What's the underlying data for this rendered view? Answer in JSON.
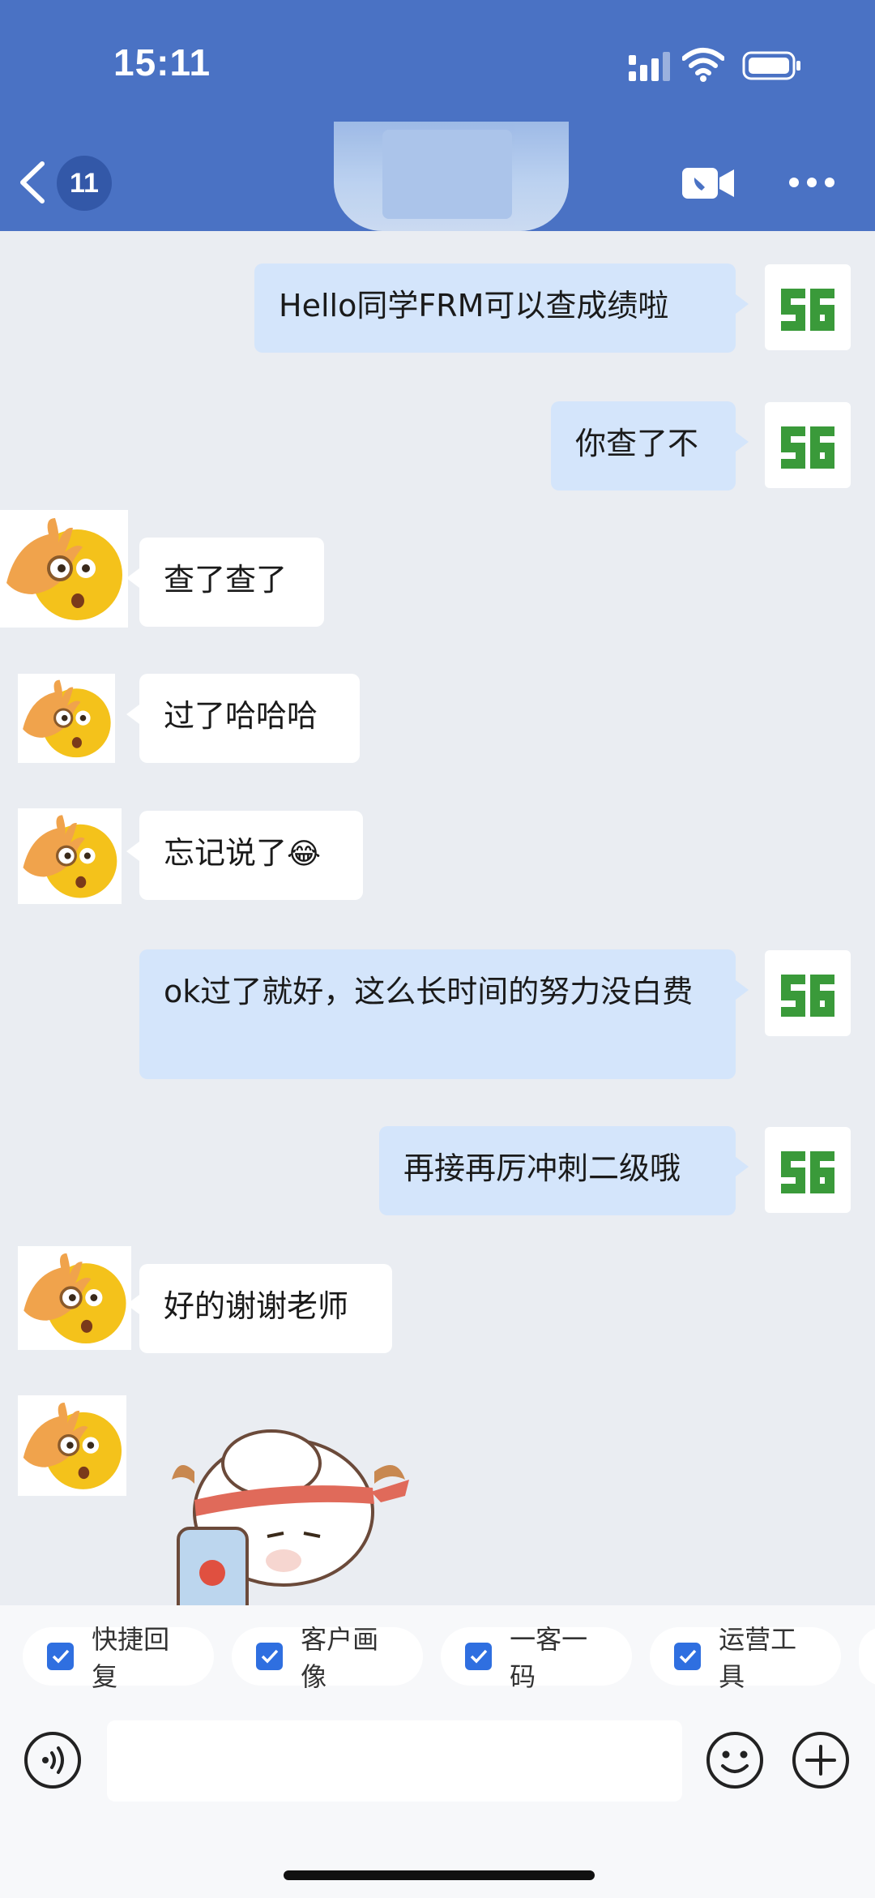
{
  "status_bar": {
    "time": "15:11"
  },
  "header": {
    "unread_count": "11"
  },
  "messages": [
    {
      "side": "out",
      "text": "Hello同学FRM可以查成绩啦"
    },
    {
      "side": "out",
      "text": "你查了不"
    },
    {
      "side": "in",
      "text": "查了查了"
    },
    {
      "side": "in",
      "text": "过了哈哈哈"
    },
    {
      "side": "in",
      "text": "忘记说了",
      "emoji": "😂"
    },
    {
      "side": "out",
      "text": "ok过了就好，这么长时间的努力没白费"
    },
    {
      "side": "out",
      "text": "再接再厉冲刺二级哦"
    },
    {
      "side": "in",
      "text": "好的谢谢老师"
    },
    {
      "side": "in",
      "sticker": "sheep-sticker"
    }
  ],
  "quick_actions": [
    {
      "label": "快捷回复"
    },
    {
      "label": "客户画像"
    },
    {
      "label": "一客一码"
    },
    {
      "label": "运营工具"
    }
  ],
  "input": {
    "placeholder": ""
  },
  "colors": {
    "header": "#4a72c4",
    "bubble_out": "#d4e5fb",
    "bubble_in": "#ffffff",
    "chip_check": "#2f6fe0"
  }
}
